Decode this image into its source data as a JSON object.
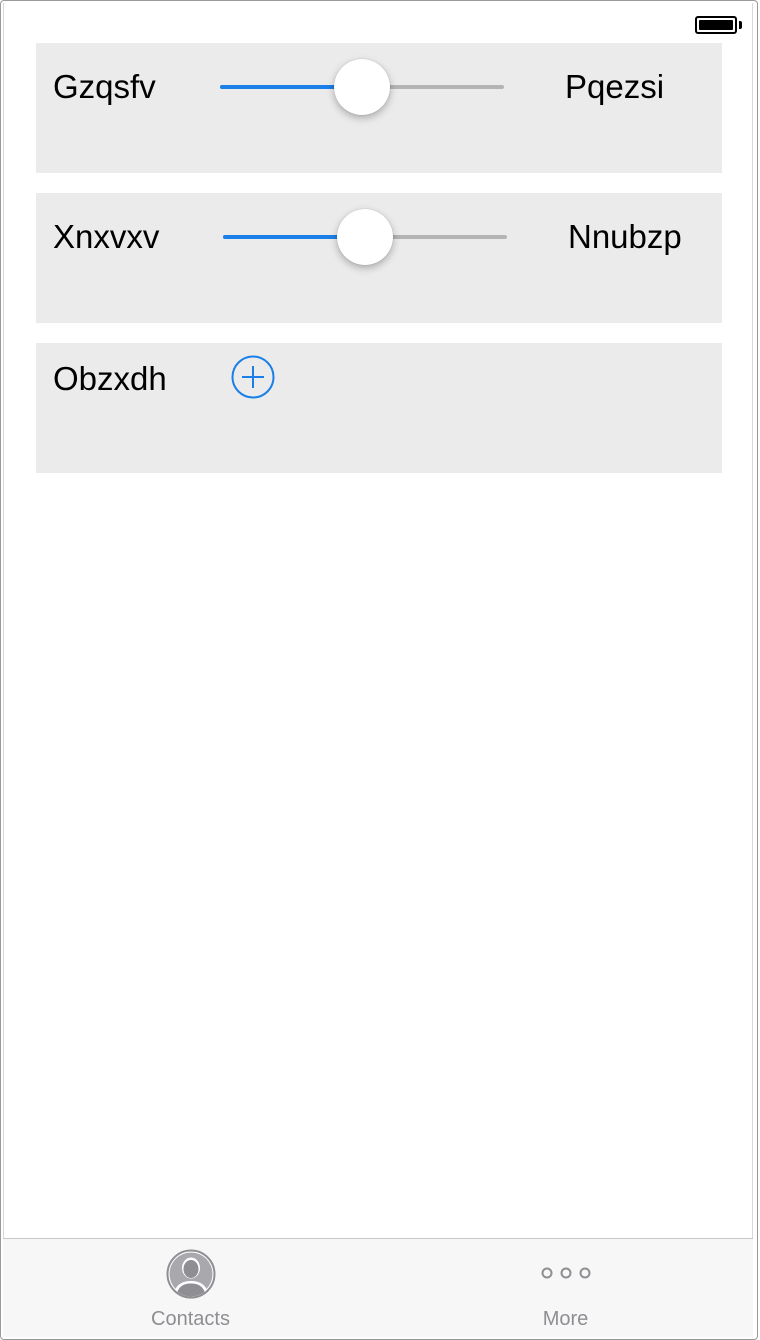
{
  "status_bar": {
    "battery_level": 1.0
  },
  "rows": [
    {
      "type": "slider",
      "label": "Gzqsfv",
      "value_label": "Pqezsi",
      "slider_value": 0.5
    },
    {
      "type": "slider",
      "label": "Xnxvxv",
      "value_label": "Nnubzp",
      "slider_value": 0.5
    },
    {
      "type": "add",
      "label": "Obzxdh",
      "button_icon": "plus-circle-icon"
    }
  ],
  "tabbar": {
    "tabs": [
      {
        "label": "Contacts",
        "icon": "contact-avatar-icon"
      },
      {
        "label": "More",
        "icon": "more-dots-icon"
      }
    ]
  },
  "colors": {
    "accent": "#1a7fe8",
    "row_background": "#ebebeb",
    "track_inactive": "#b4b4b4",
    "tab_inactive": "#8e8e93"
  }
}
